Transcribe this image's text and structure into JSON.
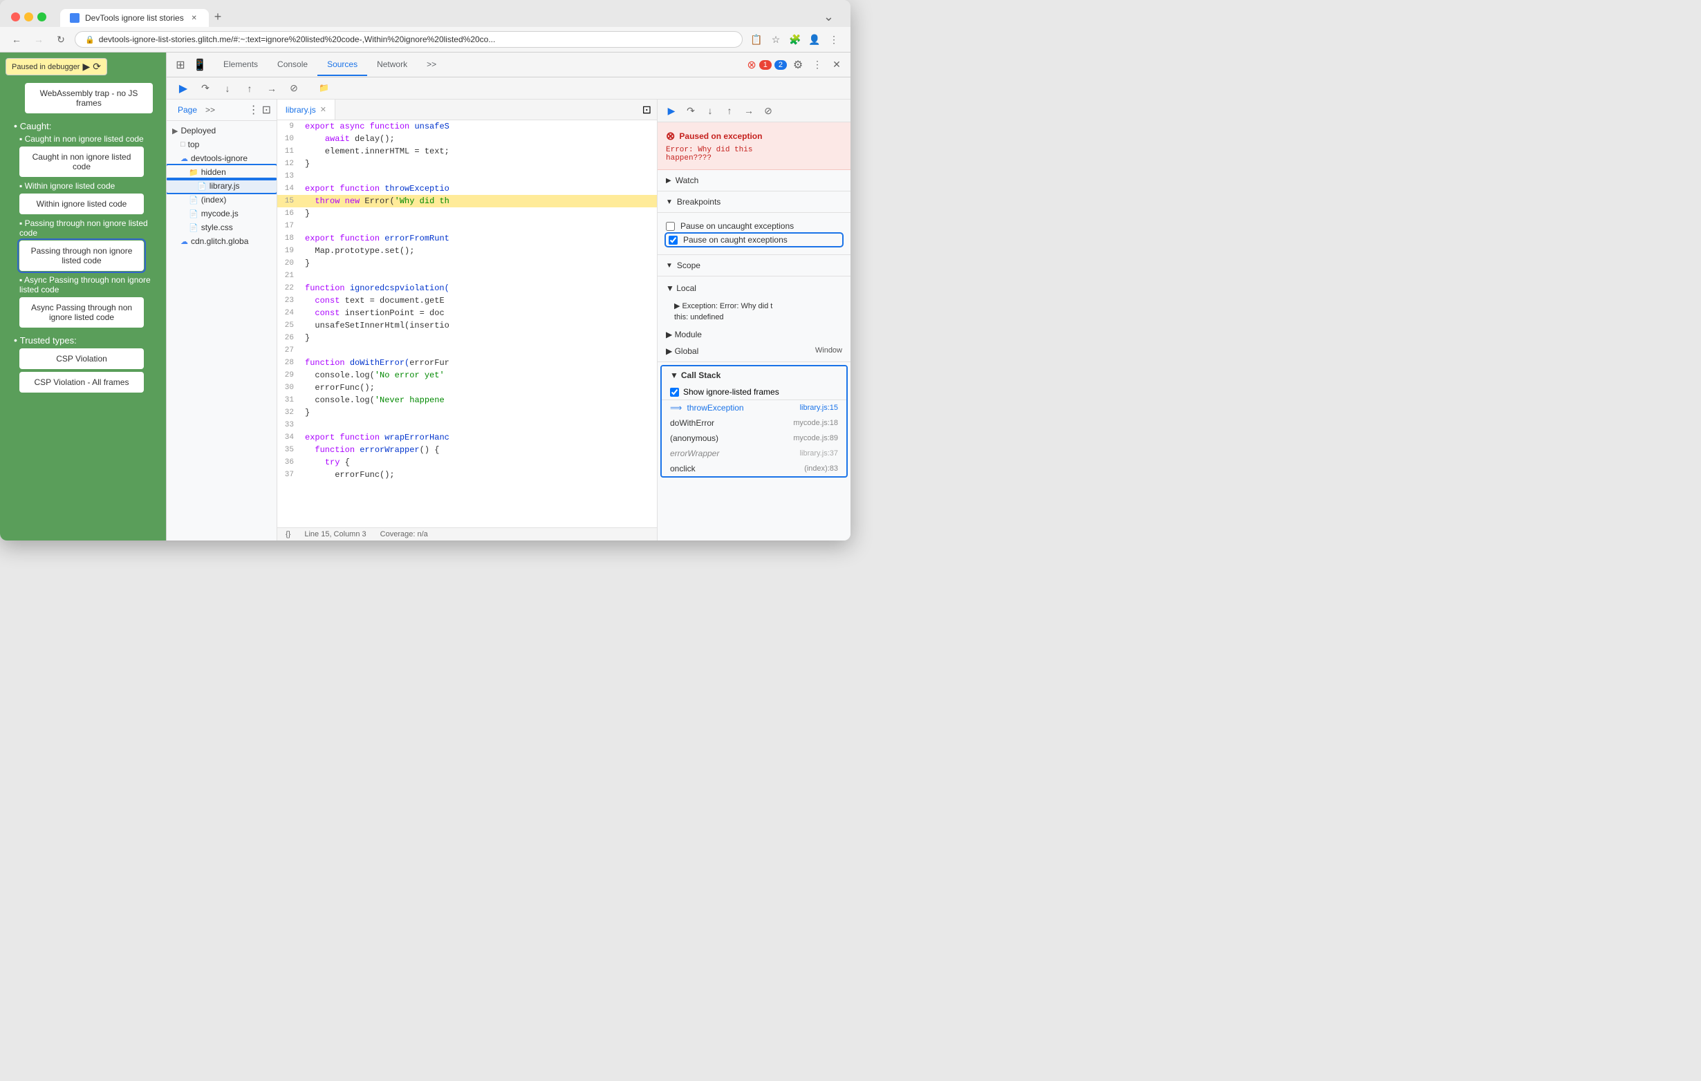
{
  "browser": {
    "tab_title": "DevTools ignore list stories",
    "url": "devtools-ignore-list-stories.glitch.me/#:~:text=ignore%20listed%20code-,Within%20ignore%20listed%20co...",
    "new_tab_icon": "+",
    "back_disabled": false,
    "forward_disabled": true
  },
  "page": {
    "debugger_badge": "Paused in debugger",
    "top_item": "WebAssembly trap - no JS frames",
    "caught_header": "Caught:",
    "items": [
      {
        "label": "Caught in non ignore listed code",
        "active": false
      },
      {
        "label": "Within ignore listed code",
        "active": false
      },
      {
        "label": "Passing through non ignore listed code",
        "active": true
      },
      {
        "label": "Async Passing through non ignore listed code",
        "active": false
      }
    ],
    "trusted_types": "Trusted types:",
    "csp_violation": "CSP Violation",
    "csp_violation_all": "CSP Violation - All frames"
  },
  "devtools": {
    "tabs": [
      "Elements",
      "Console",
      "Sources",
      "Network"
    ],
    "active_tab": "Sources",
    "error_count": "1",
    "warning_count": "2"
  },
  "file_tree": {
    "page_tab": "Page",
    "items": [
      {
        "label": "Deployed",
        "indent": 0,
        "icon": "folder",
        "type": "header"
      },
      {
        "label": "top",
        "indent": 1,
        "icon": "folder-closed"
      },
      {
        "label": "devtools-ignore",
        "indent": 1,
        "icon": "cloud",
        "expanded": true
      },
      {
        "label": "hidden",
        "indent": 2,
        "icon": "folder-open",
        "highlighted": true
      },
      {
        "label": "library.js",
        "indent": 3,
        "icon": "file",
        "highlighted": true
      },
      {
        "label": "(index)",
        "indent": 2,
        "icon": "file"
      },
      {
        "label": "mycode.js",
        "indent": 2,
        "icon": "file-orange"
      },
      {
        "label": "style.css",
        "indent": 2,
        "icon": "file-orange"
      },
      {
        "label": "cdn.glitch.globa",
        "indent": 1,
        "icon": "cloud-collapsed"
      }
    ]
  },
  "editor": {
    "tab_label": "library.js",
    "lines": [
      {
        "num": "9",
        "code": "export async function unsafeS",
        "highlight": false
      },
      {
        "num": "10",
        "code": "    await delay();",
        "highlight": false
      },
      {
        "num": "11",
        "code": "    element.innerHTML = text;",
        "highlight": false
      },
      {
        "num": "12",
        "code": "}",
        "highlight": false
      },
      {
        "num": "13",
        "code": "",
        "highlight": false
      },
      {
        "num": "14",
        "code": "export function throwExceptio",
        "highlight": false
      },
      {
        "num": "15",
        "code": "  throw new Error('Why did th",
        "highlight": true
      },
      {
        "num": "16",
        "code": "}",
        "highlight": false
      },
      {
        "num": "17",
        "code": "",
        "highlight": false
      },
      {
        "num": "18",
        "code": "export function errorFromRunt",
        "highlight": false
      },
      {
        "num": "19",
        "code": "  Map.prototype.set();",
        "highlight": false
      },
      {
        "num": "20",
        "code": "}",
        "highlight": false
      },
      {
        "num": "21",
        "code": "",
        "highlight": false
      },
      {
        "num": "22",
        "code": "function ignoredcspviolation(",
        "highlight": false
      },
      {
        "num": "23",
        "code": "  const text = document.getE",
        "highlight": false
      },
      {
        "num": "24",
        "code": "  const insertionPoint = doc",
        "highlight": false
      },
      {
        "num": "25",
        "code": "  unsafeSetInnerHtml(insertio",
        "highlight": false
      },
      {
        "num": "26",
        "code": "}",
        "highlight": false
      },
      {
        "num": "27",
        "code": "",
        "highlight": false
      },
      {
        "num": "28",
        "code": "function doWithError(errorFur",
        "highlight": false
      },
      {
        "num": "29",
        "code": "  console.log('No error yet'",
        "highlight": false
      },
      {
        "num": "30",
        "code": "  errorFunc();",
        "highlight": false
      },
      {
        "num": "31",
        "code": "  console.log('Never happene",
        "highlight": false
      },
      {
        "num": "32",
        "code": "}",
        "highlight": false
      },
      {
        "num": "33",
        "code": "",
        "highlight": false
      },
      {
        "num": "34",
        "code": "export function wrapErrorHanc",
        "highlight": false
      },
      {
        "num": "35",
        "code": "  function errorWrapper() {",
        "highlight": false
      },
      {
        "num": "36",
        "code": "    try {",
        "highlight": false
      },
      {
        "num": "37",
        "code": "      errorFunc();",
        "highlight": false
      }
    ],
    "status_line": "Line 15, Column 3",
    "coverage": "Coverage: n/a"
  },
  "right_panel": {
    "exception_title": "Paused on exception",
    "exception_msg": "Error: Why did this\nhappen????",
    "watch_label": "Watch",
    "breakpoints_label": "Breakpoints",
    "pause_uncaught_label": "Pause on uncaught exceptions",
    "pause_caught_label": "Pause on caught exceptions",
    "pause_caught_checked": true,
    "scope_label": "Scope",
    "local_label": "Local",
    "exception_scope": "▶ Exception: Error: Why did t",
    "this_scope": "this: undefined",
    "module_label": "Module",
    "global_label": "Global",
    "global_value": "Window",
    "callstack_label": "Call Stack",
    "show_ignored_label": "Show ignore-listed frames",
    "show_ignored_checked": true,
    "callstack_items": [
      {
        "fn": "throwException",
        "file": "library.js:15",
        "current": true,
        "dimmed": false
      },
      {
        "fn": "doWithError",
        "file": "mycode.js:18",
        "current": false,
        "dimmed": false
      },
      {
        "fn": "(anonymous)",
        "file": "mycode.js:89",
        "current": false,
        "dimmed": false
      },
      {
        "fn": "errorWrapper",
        "file": "library.js:37",
        "current": false,
        "dimmed": true
      },
      {
        "fn": "onclick",
        "file": "(index):83",
        "current": false,
        "dimmed": false
      }
    ]
  }
}
